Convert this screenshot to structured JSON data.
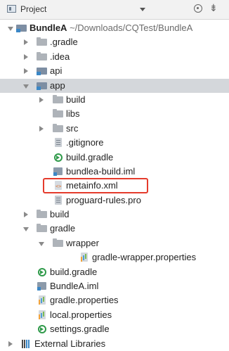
{
  "panel": {
    "title": "Project",
    "dropdown_icon": "chevron-down-icon",
    "locate_icon": "target-icon",
    "settings_icon": "settings-icon",
    "settings_glyph": "⇟"
  },
  "tree": {
    "root": {
      "name": "BundleA",
      "path": "~/Downloads/CQTest/BundleA"
    },
    "gradle_dir": ".gradle",
    "idea_dir": ".idea",
    "api_dir": "api",
    "app_dir": "app",
    "app_build": "build",
    "app_libs": "libs",
    "app_src": "src",
    "app_gitignore": ".gitignore",
    "app_build_gradle": "build.gradle",
    "app_iml": "bundlea-build.iml",
    "app_metainfo": "metainfo.xml",
    "app_xml_glyph": "<>",
    "app_proguard": "proguard-rules.pro",
    "build_dir": "build",
    "gradle_folder": "gradle",
    "wrapper_folder": "wrapper",
    "wrapper_props": "gradle-wrapper.properties",
    "root_build_gradle": "build.gradle",
    "root_iml": "BundleA.iml",
    "gradle_properties": "gradle.properties",
    "local_properties": "local.properties",
    "settings_gradle": "settings.gradle",
    "external_libraries": "External Libraries"
  },
  "colors": {
    "selection": "#d4d7db",
    "highlight_border": "#e53b2c",
    "gradle_green": "#2f9a4a"
  },
  "highlighted_item": "metainfo.xml"
}
